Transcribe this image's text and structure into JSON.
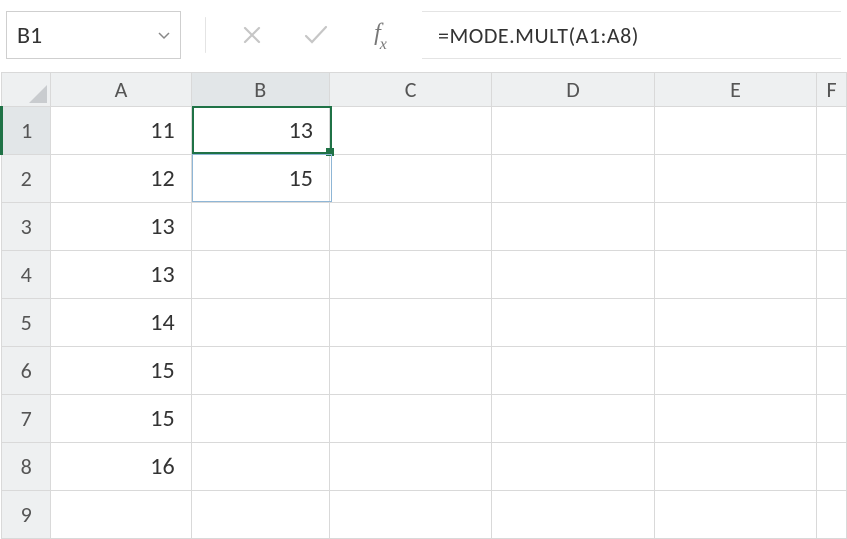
{
  "formula_bar": {
    "name_box_value": "B1",
    "formula_value": "=MODE.MULT(A1:A8)"
  },
  "columns": [
    "A",
    "B",
    "C",
    "D",
    "E",
    "F"
  ],
  "rows": [
    "1",
    "2",
    "3",
    "4",
    "5",
    "6",
    "7",
    "8",
    "9"
  ],
  "selection": {
    "active": "B1",
    "spill_end": "B2",
    "col_index": 1,
    "row_index": 0
  },
  "cells": {
    "A1": "11",
    "A2": "12",
    "A3": "13",
    "A4": "13",
    "A5": "14",
    "A6": "15",
    "A7": "15",
    "A8": "16",
    "B1": "13",
    "B2": "15"
  },
  "chart_data": {
    "type": "table",
    "columns": [
      "A",
      "B"
    ],
    "rows": [
      {
        "A": 11,
        "B": 13
      },
      {
        "A": 12,
        "B": 15
      },
      {
        "A": 13,
        "B": null
      },
      {
        "A": 13,
        "B": null
      },
      {
        "A": 14,
        "B": null
      },
      {
        "A": 15,
        "B": null
      },
      {
        "A": 15,
        "B": null
      },
      {
        "A": 16,
        "B": null
      }
    ],
    "formula": "=MODE.MULT(A1:A8)"
  }
}
